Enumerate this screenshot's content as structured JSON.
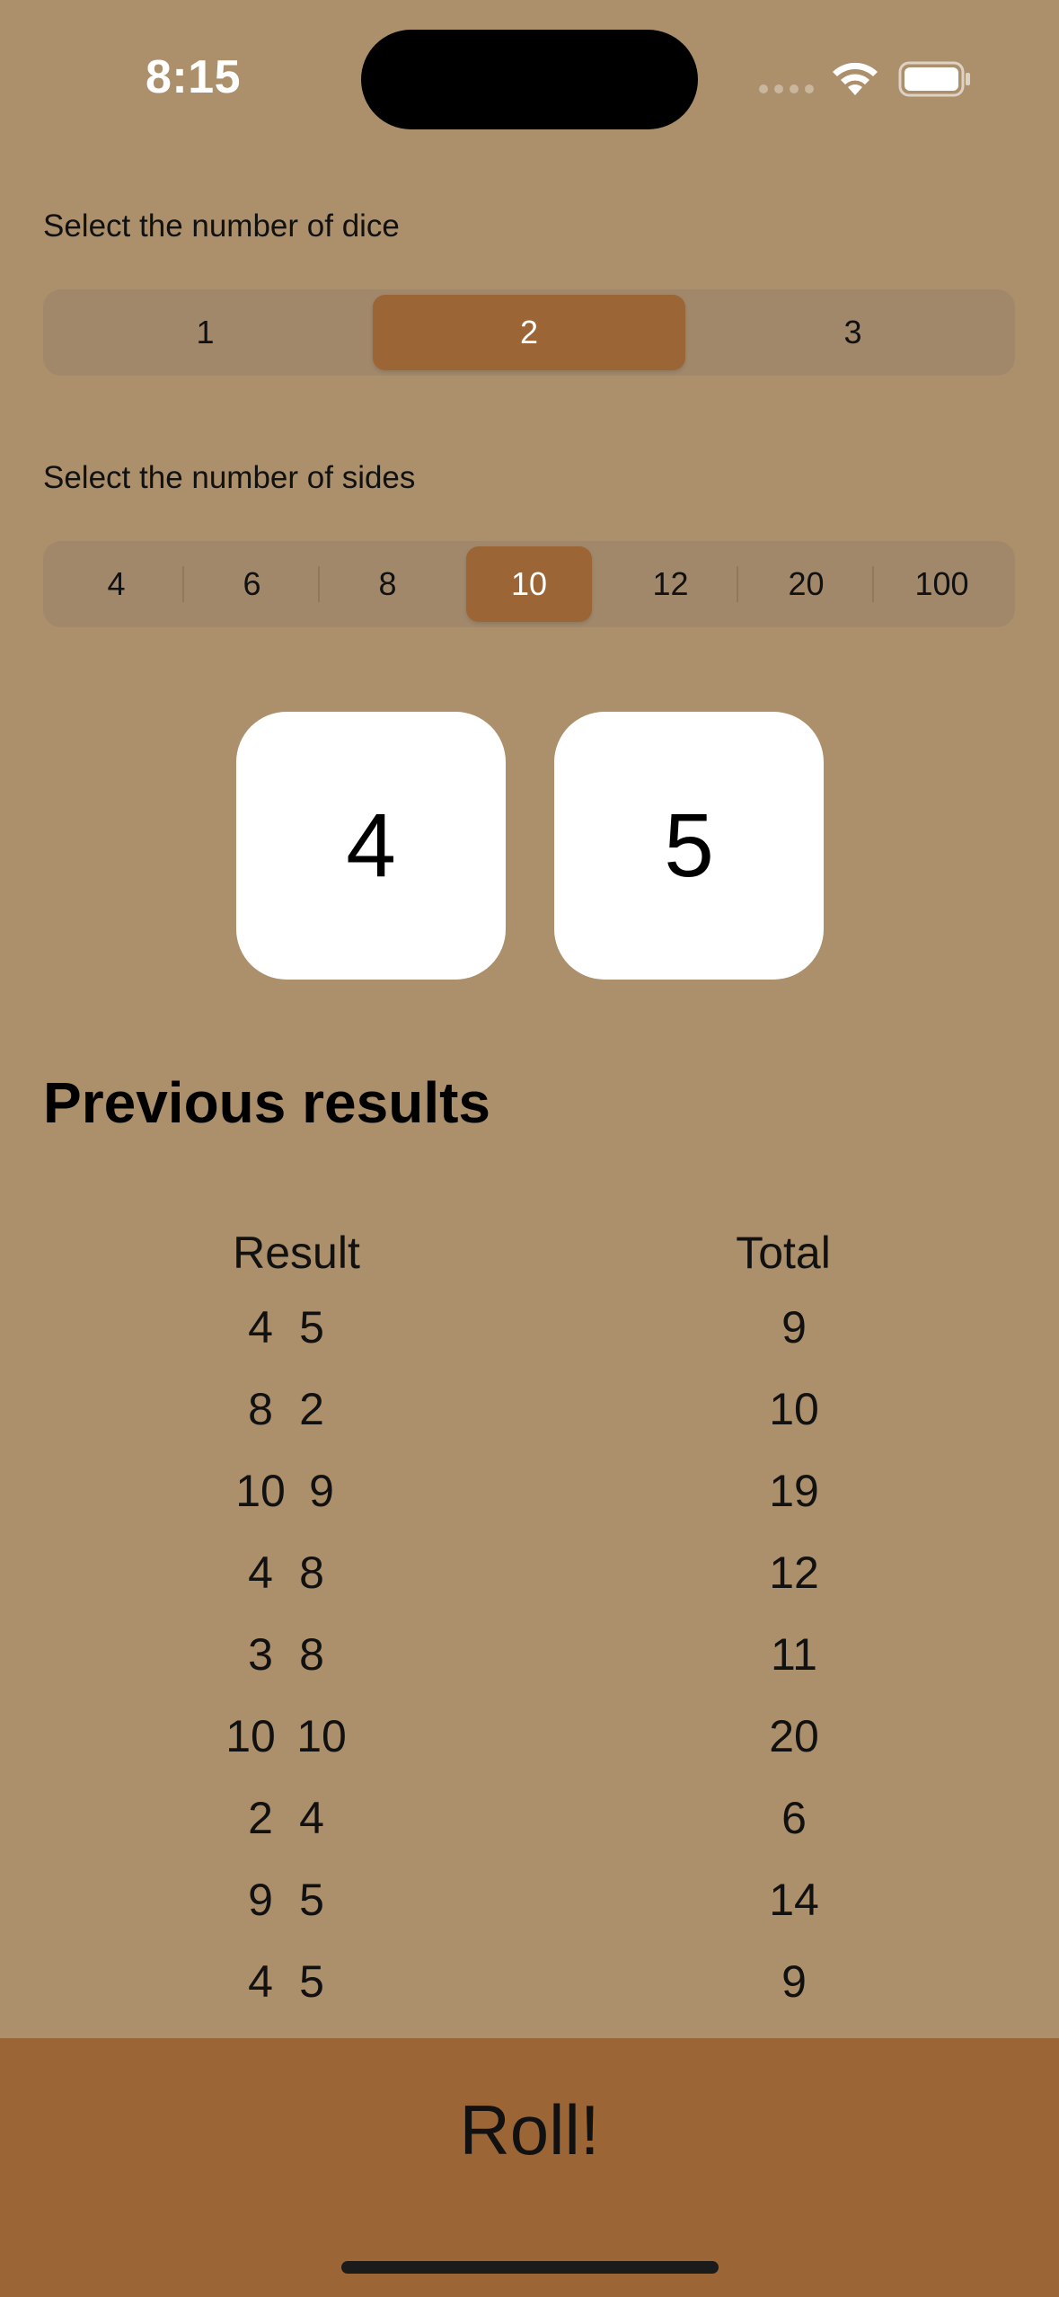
{
  "status_bar": {
    "time": "8:15",
    "icons": [
      "cellular-signal-icon",
      "wifi-icon",
      "battery-icon"
    ]
  },
  "dice_section": {
    "label": "Select the number of dice",
    "options": [
      "1",
      "2",
      "3"
    ],
    "selected": "2"
  },
  "sides_section": {
    "label": "Select the number of sides",
    "options": [
      "4",
      "6",
      "8",
      "10",
      "12",
      "20",
      "100"
    ],
    "selected": "10"
  },
  "dice": [
    "4",
    "5"
  ],
  "previous_results": {
    "title": "Previous results",
    "headers": {
      "result": "Result",
      "total": "Total"
    },
    "rows": [
      {
        "a": "4",
        "b": "5",
        "total": "9"
      },
      {
        "a": "8",
        "b": "2",
        "total": "10"
      },
      {
        "a": "10",
        "b": "9",
        "total": "19"
      },
      {
        "a": "4",
        "b": "8",
        "total": "12"
      },
      {
        "a": "3",
        "b": "8",
        "total": "11"
      },
      {
        "a": "10",
        "b": "10",
        "total": "20"
      },
      {
        "a": "2",
        "b": "4",
        "total": "6"
      },
      {
        "a": "9",
        "b": "5",
        "total": "14"
      },
      {
        "a": "4",
        "b": "5",
        "total": "9"
      }
    ]
  },
  "roll_button": {
    "label": "Roll!"
  },
  "colors": {
    "background": "#ac8f6b",
    "accent": "#9b6535",
    "die_face": "#ffffff"
  }
}
